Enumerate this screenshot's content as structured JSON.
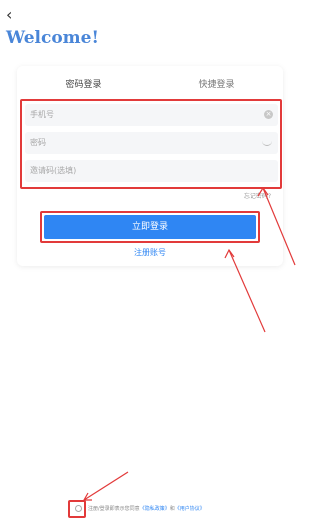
{
  "nav": {
    "back_icon": "chevron-left-icon",
    "back_glyph": "‹"
  },
  "welcome_title": "Welcome!",
  "tabs": [
    {
      "label": "密码登录",
      "active": true
    },
    {
      "label": "快捷登录",
      "active": false
    }
  ],
  "fields": {
    "phone_placeholder": "手机号",
    "password_placeholder": "密码",
    "invite_placeholder": "邀请码(选填)",
    "clear_glyph": "×"
  },
  "forgot_password": "忘记密码?",
  "login_button": "立即登录",
  "register_link": "注册账号",
  "agreement": {
    "prefix": "注册/登录即表示您同意",
    "privacy": "《隐私政策》",
    "and": "和",
    "terms": "《用户协议》"
  },
  "colors": {
    "accent": "#2f86f3",
    "annotation": "#e23a3a",
    "title": "#4a86d8"
  }
}
